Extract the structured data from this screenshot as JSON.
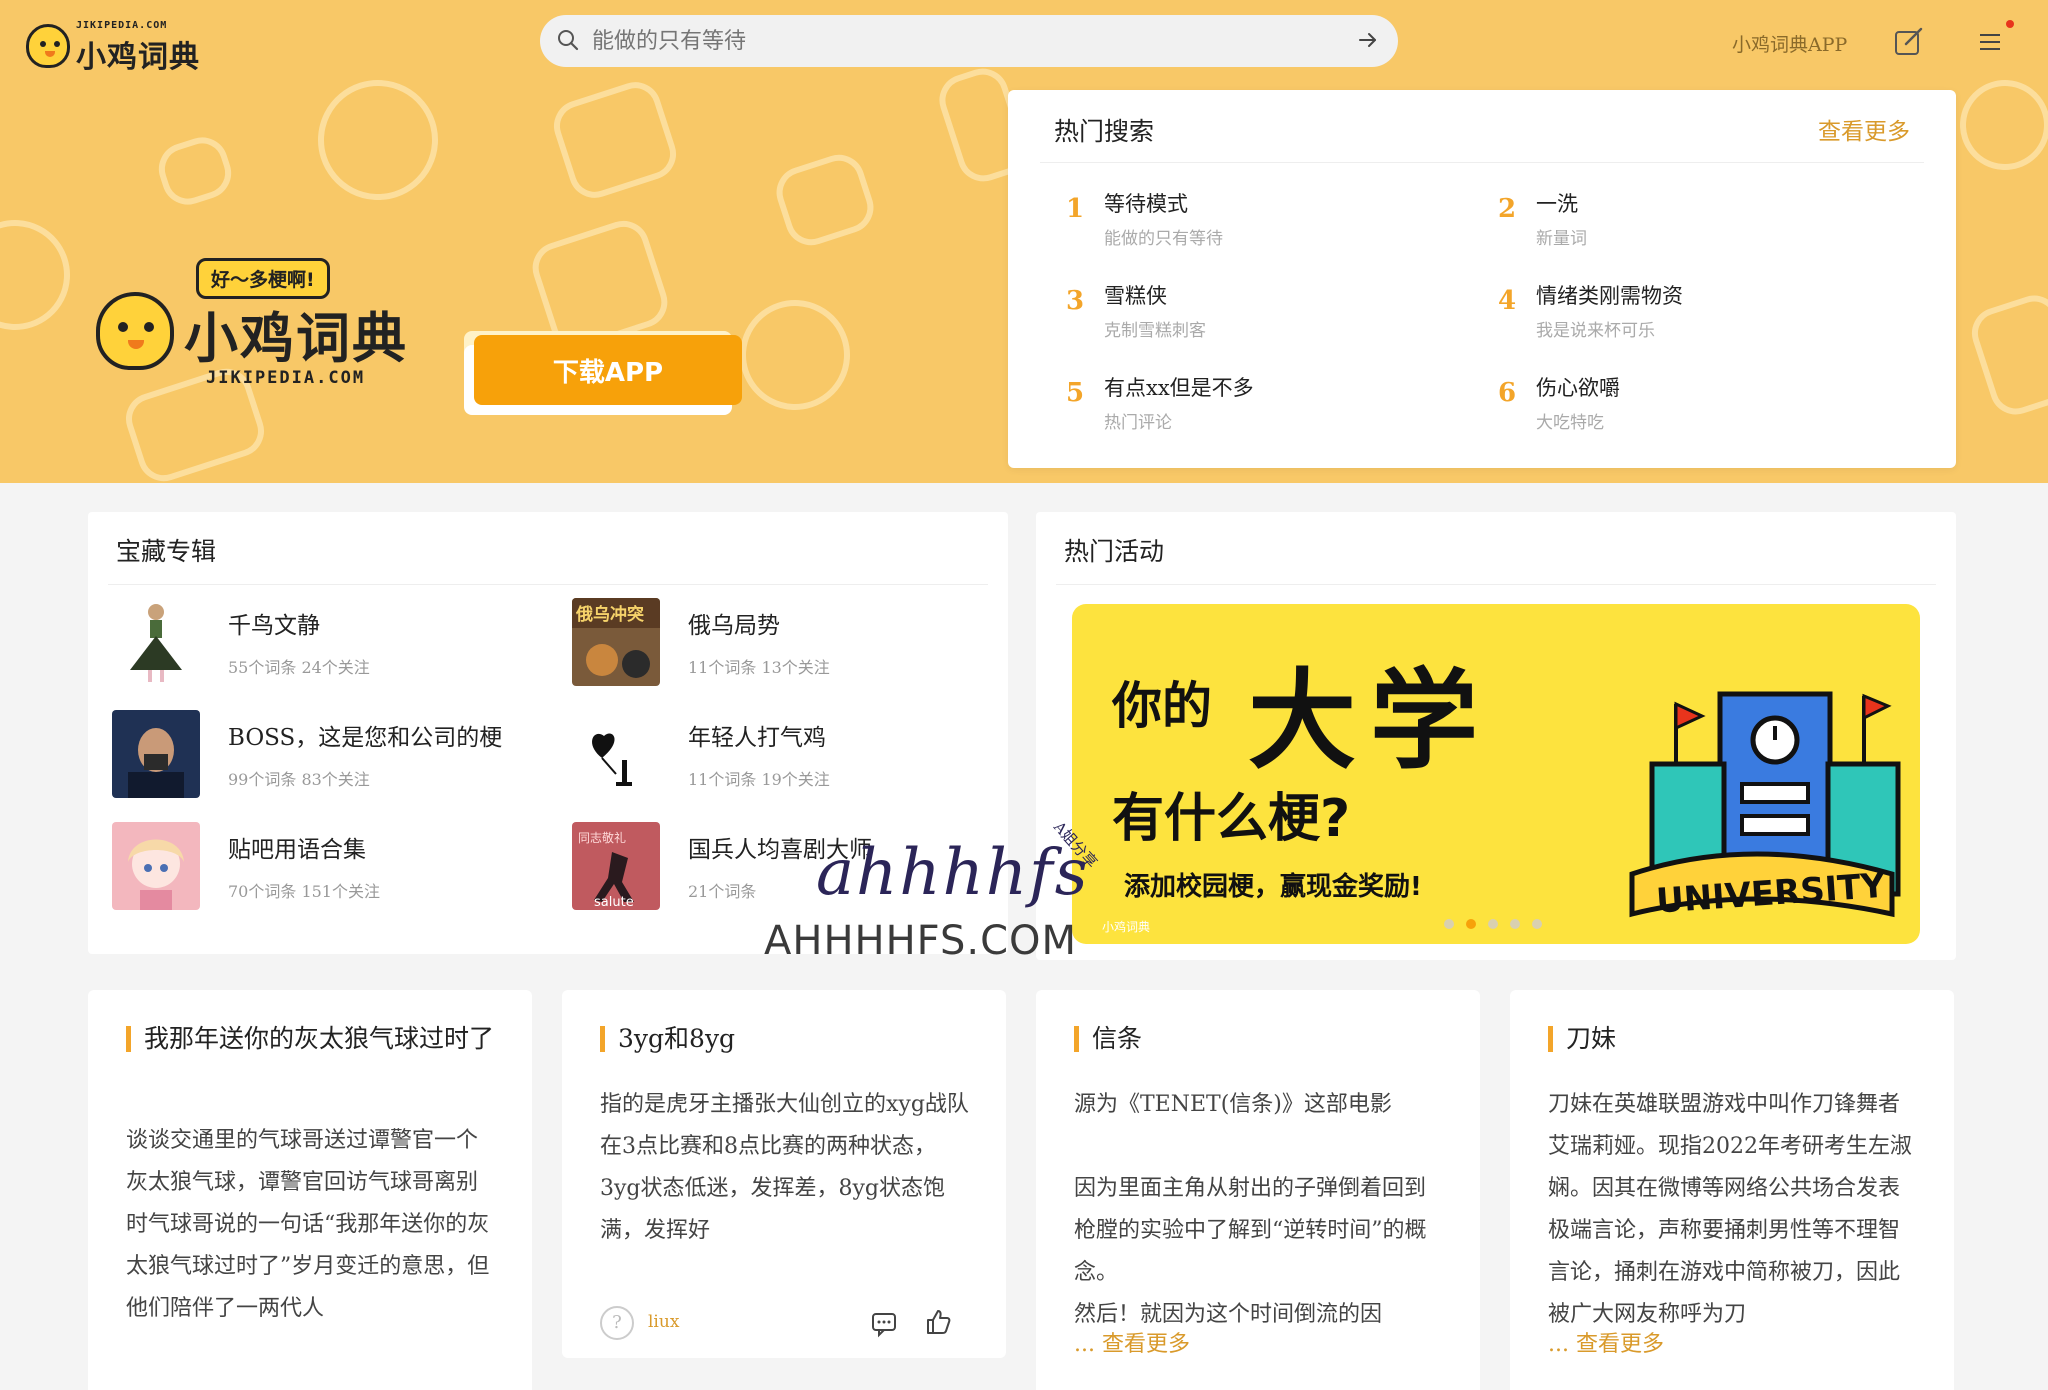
{
  "header": {
    "logo_small": "JIKIPEDIA.COM",
    "logo_text": "小鸡词典",
    "search_placeholder": "能做的只有等待",
    "app_link": "小鸡词典APP",
    "icons": [
      "search-icon",
      "arrow-right-icon",
      "edit-icon",
      "menu-icon"
    ]
  },
  "hero": {
    "slogan": "好～多梗啊!",
    "brand": "小鸡词典",
    "domain": "JIKIPEDIA.COM",
    "download_label": "下载APP",
    "background_color": "#f8c867",
    "accent_color": "#f7a10a"
  },
  "hot_search": {
    "title": "热门搜索",
    "more": "查看更多",
    "items": [
      {
        "rank": "1",
        "word": "等待模式",
        "sub": "能做的只有等待"
      },
      {
        "rank": "2",
        "word": "一洗",
        "sub": "新量词"
      },
      {
        "rank": "3",
        "word": "雪糕侠",
        "sub": "克制雪糕刺客"
      },
      {
        "rank": "4",
        "word": "情绪类刚需物资",
        "sub": "我是说来杯可乐"
      },
      {
        "rank": "5",
        "word": "有点xx但是不多",
        "sub": "热门评论"
      },
      {
        "rank": "6",
        "word": "伤心欲嚼",
        "sub": "大吃特吃"
      }
    ]
  },
  "albums": {
    "title": "宝藏专辑",
    "items": [
      {
        "name": "千鸟文静",
        "meta": "55个词条  24个关注"
      },
      {
        "name": "俄乌局势",
        "meta": "11个词条  13个关注"
      },
      {
        "name": "BOSS，这是您和公司的梗",
        "meta": "99个词条  83个关注"
      },
      {
        "name": "年轻人打气鸡",
        "meta": "11个词条  19个关注"
      },
      {
        "name": "贴吧用语合集",
        "meta": "70个词条  151个关注"
      },
      {
        "name": "国兵人均喜剧大师",
        "meta": "21个词条"
      }
    ],
    "thumb_texts": {
      "war": "俄乌冲突",
      "salute_top": "同志敬礼",
      "salute_bottom": "salute"
    }
  },
  "activity": {
    "title": "热门活动",
    "banner": {
      "line1a": "你的",
      "line1b": "大学",
      "line2": "有什么梗?",
      "line3": "添加校园梗，赢现金奖励!",
      "building_text": "UNIVERSITY",
      "corner": "小鸡词典"
    },
    "carousel_active": 1,
    "carousel_count": 5
  },
  "word_cards": [
    {
      "title": "我那年送你的灰太狼气球过时了",
      "body": "谈谈交通里的气球哥送过谭警官一个灰太狼气球，谭警官回访气球哥离别时气球哥说的一句话“我那年送你的灰太狼气球过时了”岁月变迁的意思，但他们陪伴了一两代人"
    },
    {
      "title": "3yg和8yg",
      "body": "指的是虎牙主播张大仙创立的xyg战队在3点比赛和8点比赛的两种状态，3yg状态低迷，发挥差，8yg状态饱满，发挥好",
      "author": "liux"
    },
    {
      "title": "信条",
      "body": "源为《TENET(信条)》这部电影\n\n因为里面主角从射出的子弹倒着回到枪膛的实验中了解到“逆转时间”的概念。\n然后！就因为这个时间倒流的因",
      "more": "... 查看更多"
    },
    {
      "title": "刀妹",
      "body": "刀妹在英雄联盟游戏中叫作刀锋舞者艾瑞莉娅。现指2022年考研考生左淑娴。因其在微博等网络公共场合发表极端言论，声称要捅刺男性等不理智言论，捅刺在游戏中简称被刀，因此被广大网友称呼为刀",
      "more": "... 查看更多"
    }
  ],
  "watermark": {
    "script": "ahhhhfs",
    "domain": "AHHHHFS.COM",
    "tag": "A姐分享"
  }
}
